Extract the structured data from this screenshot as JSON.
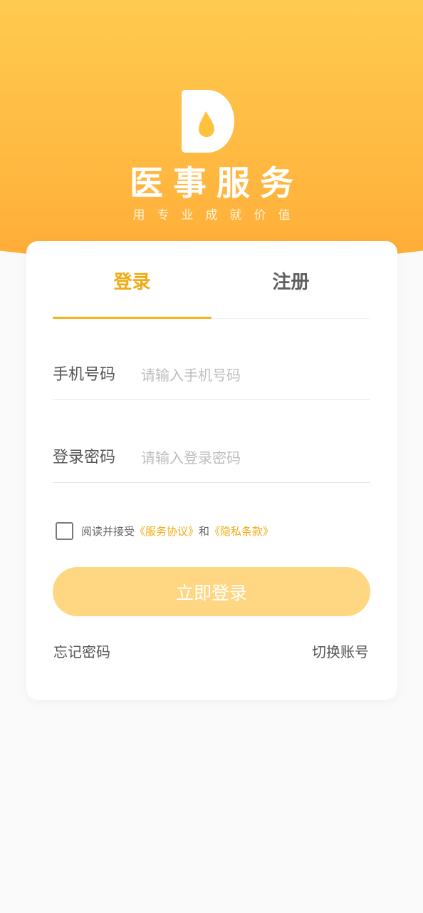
{
  "header": {
    "logo_icon": "droplet-d-logo",
    "app_title": "医事服务",
    "slogan": "用专业成就价值"
  },
  "tabs": [
    {
      "label": "登录",
      "active": true
    },
    {
      "label": "注册",
      "active": false
    }
  ],
  "form": {
    "phone": {
      "label": "手机号码",
      "placeholder": "请输入手机号码",
      "value": ""
    },
    "password": {
      "label": "登录密码",
      "placeholder": "请输入登录密码",
      "value": ""
    }
  },
  "agreement": {
    "checked": false,
    "prefix": "阅读并接受",
    "service_link": "《服务协议》",
    "and": "和",
    "privacy_link": "《隐私条款》"
  },
  "login_button": "立即登录",
  "links": {
    "forgot": "忘记密码",
    "switch": "切换账号"
  },
  "colors": {
    "accent": "#f0ab12",
    "header_gradient_top": "#ffce52",
    "header_gradient_bottom": "#ffab35",
    "button_disabled": "#ffd782",
    "background": "#fafafa"
  }
}
